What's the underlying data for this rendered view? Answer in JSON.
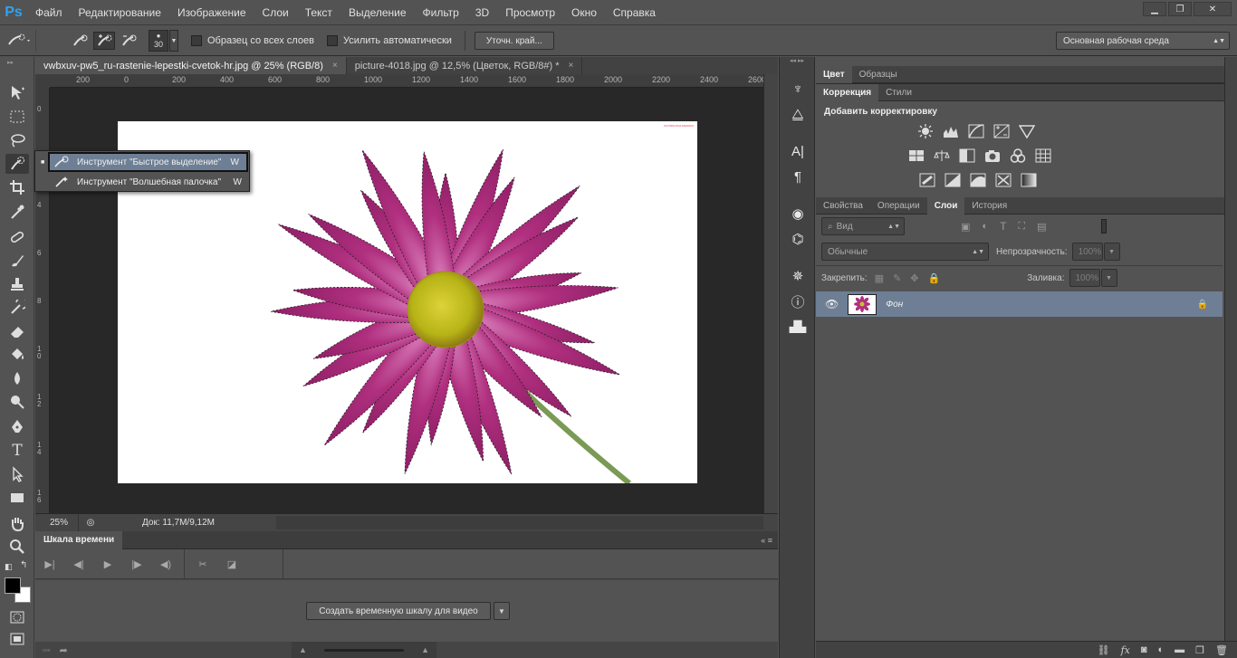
{
  "app": {
    "logo": "Ps"
  },
  "menu": [
    "Файл",
    "Редактирование",
    "Изображение",
    "Слои",
    "Текст",
    "Выделение",
    "Фильтр",
    "3D",
    "Просмотр",
    "Окно",
    "Справка"
  ],
  "options": {
    "brush_size": "30",
    "sample_all_layers": "Образец со всех слоев",
    "auto_enhance": "Усилить автоматически",
    "refine_edge": "Уточн. край...",
    "workspace": "Основная рабочая среда"
  },
  "documents": {
    "tabs": [
      {
        "label": "vwbxuv-pw5_ru-rastenie-lepestki-cvetok-hr.jpg @ 25% (RGB/8)",
        "close": "×"
      },
      {
        "label": "picture-4018.jpg @ 12,5% (Цветок, RGB/8#) *",
        "close": "×"
      }
    ],
    "ruler_top": [
      "200",
      "0",
      "200",
      "400",
      "600",
      "800",
      "1000",
      "1200",
      "1400",
      "1600",
      "1800",
      "2000",
      "2200",
      "2400",
      "2600"
    ],
    "ruler_left": [
      "0",
      "2",
      "4",
      "6",
      "8",
      "1 0",
      "1 2",
      "1 4",
      "1 6"
    ],
    "watermark": "KOTNIKOVA DESIGN"
  },
  "status": {
    "zoom": "25%",
    "doc": "Док: 11,7M/9,12M"
  },
  "flyout": {
    "items": [
      {
        "label": "Инструмент \"Быстрое выделение\"",
        "key": "W"
      },
      {
        "label": "Инструмент \"Волшебная палочка\"",
        "key": "W"
      }
    ]
  },
  "timeline": {
    "title": "Шкала времени",
    "create_button": "Создать временную шкалу для видео"
  },
  "panels": {
    "color_tabs": [
      "Цвет",
      "Образцы"
    ],
    "adj_tabs": [
      "Коррекция",
      "Стили"
    ],
    "adj_title": "Добавить корректировку",
    "layer_tabs": [
      "Свойства",
      "Операции",
      "Слои",
      "История"
    ],
    "kind": "Вид",
    "blend_mode": "Обычные",
    "opacity_label": "Непрозрачность:",
    "opacity_value": "100%",
    "lock_label": "Закрепить:",
    "fill_label": "Заливка:",
    "fill_value": "100%",
    "layer_name": "Фон"
  },
  "colors": {
    "accent": "#6e7f95",
    "ps_blue": "#2fa3f0",
    "flower": "#b0307f"
  }
}
